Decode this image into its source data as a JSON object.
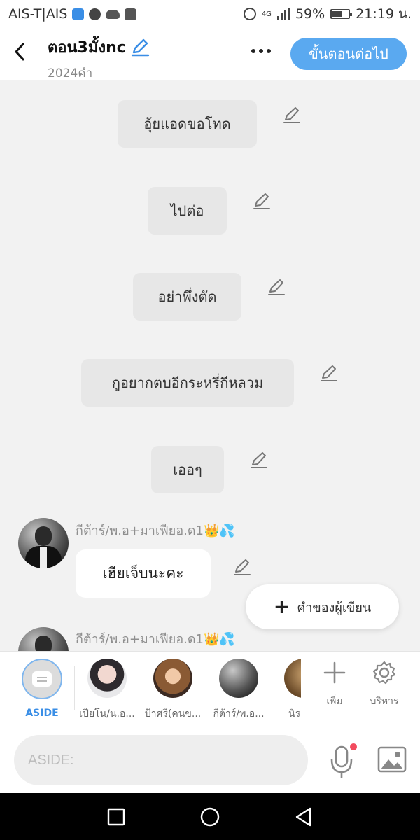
{
  "status_bar": {
    "carrier": "AIS-T|AIS",
    "network": "4G",
    "battery": "59%",
    "battery_level": 0.59,
    "time": "21:19 น.",
    "icons": [
      "shield-icon",
      "messenger-icon",
      "cloud-icon",
      "facebook-icon",
      "alarm-icon",
      "signal-icon",
      "battery-icon"
    ]
  },
  "header": {
    "title": "ตอน3มั้งnc",
    "subtitle": "2024คำ",
    "next_label": "ขั้นตอนต่อไป"
  },
  "chat": {
    "narrations": [
      {
        "text": "อุ้ยแอดขอโทด"
      },
      {
        "text": "ไปต่อ"
      },
      {
        "text": "อย่าพึ่งตัด"
      },
      {
        "text": "กูอยากตบอีกระหรี่กีหลวม"
      },
      {
        "text": "เออๆ"
      }
    ],
    "messages": [
      {
        "name": "กีต้าร์/พ.อ+มาเฟียอ.ด1👑💦",
        "text": "เฮียเจ็บนะคะ"
      },
      {
        "name": "กีต้าร์/พ.อ+มาเฟียอ.ด1👑💦",
        "text": ""
      }
    ],
    "author_note_label": "คำของผู้เขียน"
  },
  "characters": {
    "aside_label": "ASIDE",
    "items": [
      {
        "label": "เปียโน/น.อ..."
      },
      {
        "label": "ป้าศรี(คนข..."
      },
      {
        "label": "กีต้าร์/พ.อ..."
      },
      {
        "label": "นิร"
      }
    ],
    "add_label": "เพิ่ม",
    "manage_label": "บริหาร"
  },
  "input": {
    "placeholder": "ASIDE:"
  },
  "colors": {
    "accent": "#5aa9f0",
    "aside_blue": "#3a8ee6",
    "notification_dot": "#f24b5e"
  }
}
